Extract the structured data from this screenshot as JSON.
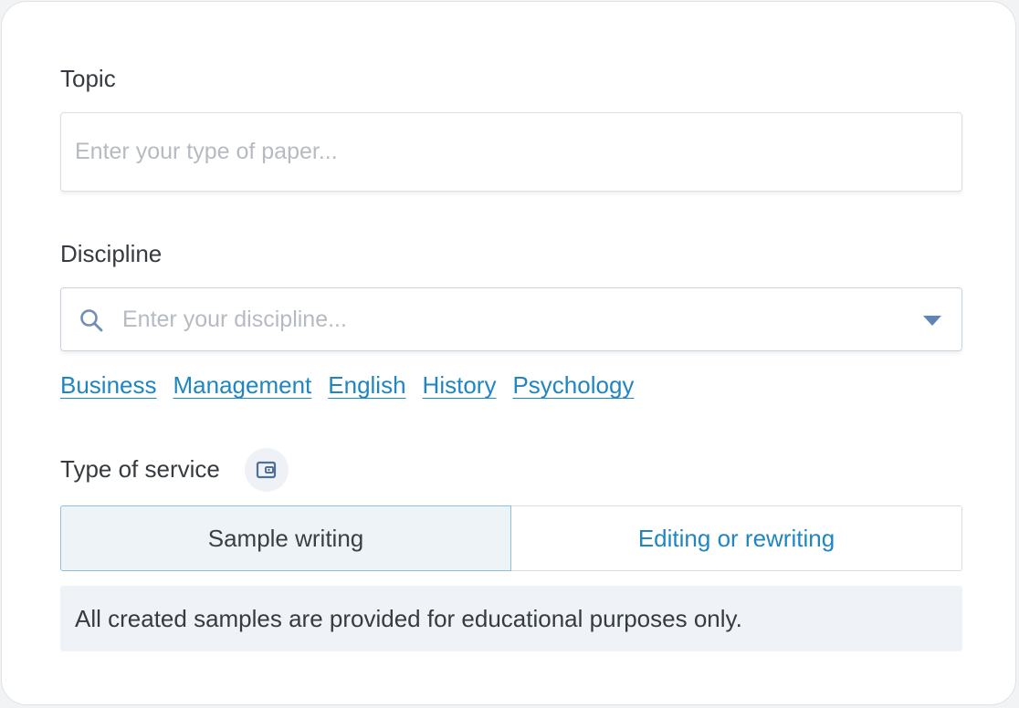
{
  "topic": {
    "label": "Topic",
    "placeholder": "Enter your type of paper...",
    "value": ""
  },
  "discipline": {
    "label": "Discipline",
    "placeholder": "Enter your discipline...",
    "value": "",
    "suggestions": [
      "Business",
      "Management",
      "English",
      "History",
      "Psychology"
    ]
  },
  "service": {
    "label": "Type of service",
    "info_icon": "wallet-icon",
    "options": [
      {
        "label": "Sample writing",
        "selected": true
      },
      {
        "label": "Editing or rewriting",
        "selected": false
      }
    ],
    "note": "All created samples are provided for educational purposes only."
  },
  "colors": {
    "accent": "#1f86c2",
    "selected_bg": "#eef3f8",
    "selected_border": "#8fc0e0",
    "note_bg": "#eff3f7"
  }
}
